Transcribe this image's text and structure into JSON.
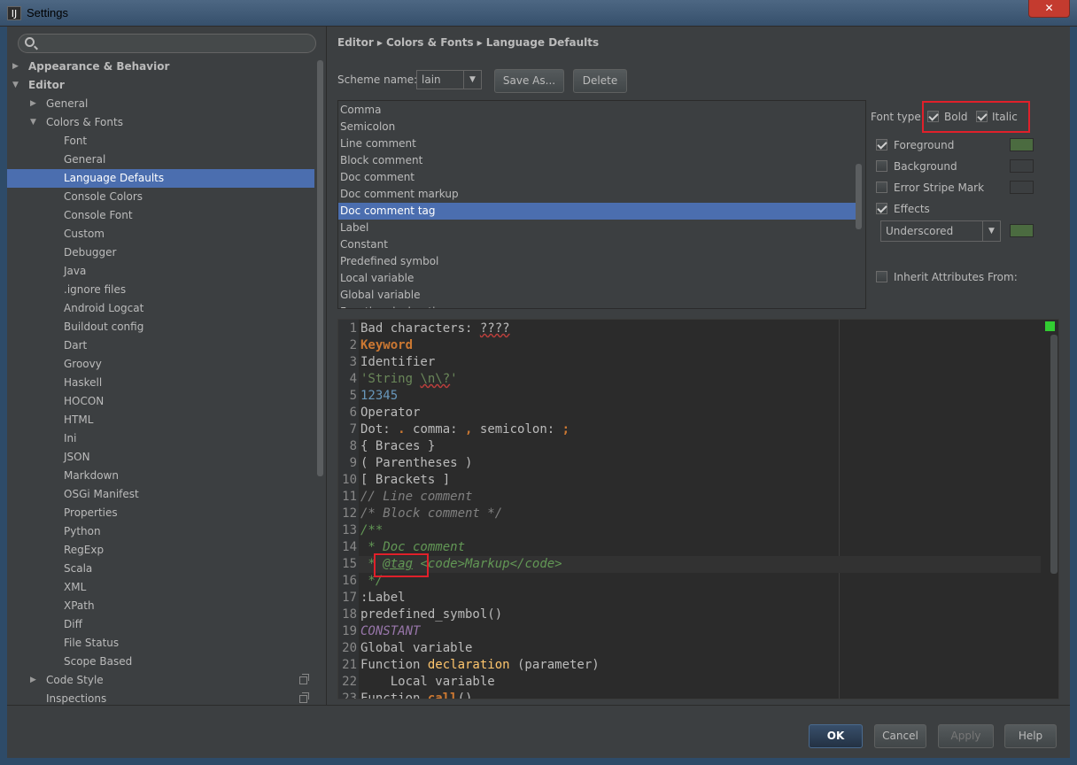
{
  "window": {
    "title": "Settings",
    "close_label": "✕"
  },
  "search": {
    "placeholder": ""
  },
  "tree": [
    {
      "label": "Appearance & Behavior",
      "level": 0,
      "arrow": "▶",
      "bold": true
    },
    {
      "label": "Editor",
      "level": 0,
      "arrow": "▼",
      "bold": true
    },
    {
      "label": "General",
      "level": 1,
      "arrow": "▶"
    },
    {
      "label": "Colors & Fonts",
      "level": 1,
      "arrow": "▼"
    },
    {
      "label": "Font",
      "level": 2
    },
    {
      "label": "General",
      "level": 2
    },
    {
      "label": "Language Defaults",
      "level": 2,
      "selected": true
    },
    {
      "label": "Console Colors",
      "level": 2
    },
    {
      "label": "Console Font",
      "level": 2
    },
    {
      "label": "Custom",
      "level": 2
    },
    {
      "label": "Debugger",
      "level": 2
    },
    {
      "label": "Java",
      "level": 2
    },
    {
      "label": ".ignore files",
      "level": 2
    },
    {
      "label": "Android Logcat",
      "level": 2
    },
    {
      "label": "Buildout config",
      "level": 2
    },
    {
      "label": "Dart",
      "level": 2
    },
    {
      "label": "Groovy",
      "level": 2
    },
    {
      "label": "Haskell",
      "level": 2
    },
    {
      "label": "HOCON",
      "level": 2
    },
    {
      "label": "HTML",
      "level": 2
    },
    {
      "label": "Ini",
      "level": 2
    },
    {
      "label": "JSON",
      "level": 2
    },
    {
      "label": "Markdown",
      "level": 2
    },
    {
      "label": "OSGi Manifest",
      "level": 2
    },
    {
      "label": "Properties",
      "level": 2
    },
    {
      "label": "Python",
      "level": 2
    },
    {
      "label": "RegExp",
      "level": 2
    },
    {
      "label": "Scala",
      "level": 2
    },
    {
      "label": "XML",
      "level": 2
    },
    {
      "label": "XPath",
      "level": 2
    },
    {
      "label": "Diff",
      "level": 2
    },
    {
      "label": "File Status",
      "level": 2
    },
    {
      "label": "Scope Based",
      "level": 2
    },
    {
      "label": "Code Style",
      "level": 1,
      "arrow": "▶",
      "copy": true
    },
    {
      "label": "Inspections",
      "level": 1,
      "copy": true
    }
  ],
  "breadcrumb": [
    "Editor",
    "Colors & Fonts",
    "Language Defaults"
  ],
  "scheme": {
    "label": "Scheme name:",
    "value": "lain",
    "save_as": "Save As...",
    "delete": "Delete"
  },
  "attributes": [
    "Comma",
    "Semicolon",
    "Line comment",
    "Block comment",
    "Doc comment",
    "Doc comment markup",
    "Doc comment tag",
    "Label",
    "Constant",
    "Predefined symbol",
    "Local variable",
    "Global variable",
    "Function declaration"
  ],
  "selected_attribute_index": 6,
  "options": {
    "font_type_label": "Font type:",
    "bold": {
      "label": "Bold",
      "checked": true
    },
    "italic": {
      "label": "Italic",
      "checked": true
    },
    "foreground": {
      "label": "Foreground",
      "checked": true,
      "color": "#4b6b40"
    },
    "background": {
      "label": "Background",
      "checked": false,
      "color": "#3c3f41"
    },
    "error_stripe": {
      "label": "Error Stripe Mark",
      "checked": false,
      "color": "#3c3f41"
    },
    "effects": {
      "label": "Effects",
      "checked": true,
      "type": "Underscored",
      "color": "#4b6b40"
    },
    "inherit": {
      "label": "Inherit Attributes From:",
      "checked": false
    }
  },
  "preview_lines": [
    [
      [
        "Bad characters: ",
        ""
      ],
      [
        "????",
        "c-wave"
      ]
    ],
    [
      [
        "Keyword",
        "c-kw"
      ]
    ],
    [
      [
        "Identifier",
        ""
      ]
    ],
    [
      [
        "'String ",
        "c-str"
      ],
      [
        "\\n\\?",
        "c-str c-wave"
      ],
      [
        "'",
        "c-str"
      ]
    ],
    [
      [
        "12345",
        "c-num"
      ]
    ],
    [
      [
        "Operator",
        ""
      ]
    ],
    [
      [
        "Dot: ",
        ""
      ],
      [
        ".",
        "c-kw"
      ],
      [
        " comma: ",
        ""
      ],
      [
        ",",
        "c-kw"
      ],
      [
        " semicolon: ",
        ""
      ],
      [
        ";",
        "c-kw"
      ]
    ],
    [
      [
        "{ Braces }",
        ""
      ]
    ],
    [
      [
        "( Parentheses )",
        ""
      ]
    ],
    [
      [
        "[ Brackets ]",
        ""
      ]
    ],
    [
      [
        "// Line comment",
        "c-com"
      ]
    ],
    [
      [
        "/* Block comment */",
        "c-com"
      ]
    ],
    [
      [
        "/**",
        "c-doc"
      ]
    ],
    [
      [
        " * Doc comment",
        "c-doc"
      ]
    ],
    [
      [
        " * ",
        "c-doc"
      ],
      [
        "@",
        "c-tag"
      ],
      [
        "tag",
        "c-tag"
      ],
      [
        " <code>Markup</code>",
        "c-doc"
      ]
    ],
    [
      [
        " */",
        "c-doc"
      ]
    ],
    [
      [
        ":Label",
        ""
      ]
    ],
    [
      [
        "predefined_symbol()",
        ""
      ]
    ],
    [
      [
        "CONSTANT",
        "c-const"
      ]
    ],
    [
      [
        "Global variable",
        ""
      ]
    ],
    [
      [
        "Function ",
        ""
      ],
      [
        "declaration",
        "c-fn"
      ],
      [
        " (parameter)",
        ""
      ]
    ],
    [
      [
        "    Local variable",
        ""
      ]
    ],
    [
      [
        "Function ",
        ""
      ],
      [
        "call",
        "c-kw"
      ],
      [
        "()",
        ""
      ]
    ]
  ],
  "footer": {
    "ok": "OK",
    "cancel": "Cancel",
    "apply": "Apply",
    "help": "Help"
  }
}
